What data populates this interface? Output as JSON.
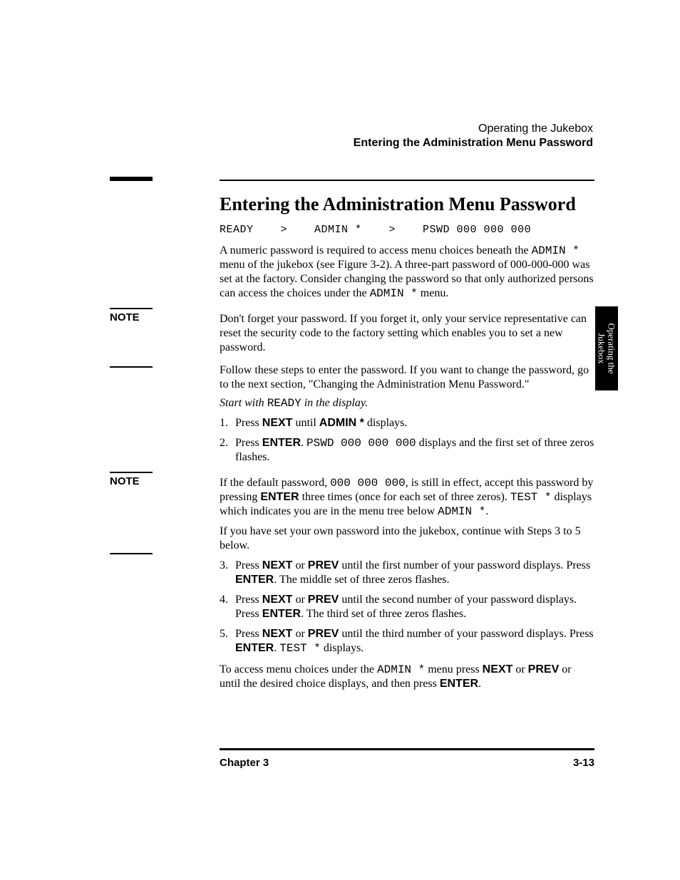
{
  "header": {
    "chapter_name": "Operating the Jukebox",
    "section_name": "Entering the Administration Menu Password"
  },
  "side_tab": {
    "line1": "Operating the",
    "line2": "Jukebox"
  },
  "title": "Entering the Administration Menu Password",
  "display_sequence": "READY    >    ADMIN *    >    PSWD 000 000 000",
  "intro_para": {
    "t1": "A numeric password is required to access menu choices beneath the ",
    "mono1": "ADMIN *",
    "t2": " menu of the jukebox (see Figure 3-2). A three-part password of 000-000-000 was set at the factory. Consider changing the password so that only authorized persons can access the choices under the ",
    "mono2": "ADMIN *",
    "t3": " menu."
  },
  "note1": {
    "label": "NOTE",
    "text": "Don't forget your password. If you forget it, only your service representative can reset the security code to the factory setting which enables you to set a new password."
  },
  "follow_para": "Follow these steps to enter the password. If you want to change the password, go to the next section, \"Changing the Administration Menu Password.\"",
  "start_line": {
    "t1": "Start with ",
    "mono": "READY",
    "t2": " in the display."
  },
  "steps_a": [
    {
      "num": "1.",
      "parts": [
        {
          "text": "Press "
        },
        {
          "text": "NEXT",
          "cls": "sans bold"
        },
        {
          "text": " until "
        },
        {
          "text": "ADMIN *",
          "cls": "sans bold"
        },
        {
          "text": " displays."
        }
      ]
    },
    {
      "num": "2.",
      "parts": [
        {
          "text": "Press "
        },
        {
          "text": "ENTER",
          "cls": "sans bold"
        },
        {
          "text": ". "
        },
        {
          "text": "PSWD 000 000 000",
          "cls": "mono"
        },
        {
          "text": " displays and the first set of three zeros flashes."
        }
      ]
    }
  ],
  "note2": {
    "label": "NOTE",
    "parts": [
      {
        "text": "If the default password, "
      },
      {
        "text": "000 000 000",
        "cls": "mono"
      },
      {
        "text": ", is still in effect, accept this password by pressing "
      },
      {
        "text": "ENTER",
        "cls": "sans bold"
      },
      {
        "text": " three times (once for each set of three zeros).  "
      },
      {
        "text": "TEST *",
        "cls": "mono"
      },
      {
        "text": " displays which indicates you are in the menu tree below "
      },
      {
        "text": "ADMIN *",
        "cls": "mono"
      },
      {
        "text": "."
      }
    ]
  },
  "ifown_para": "If you have set your own password into the jukebox, continue with Steps 3 to 5 below.",
  "steps_b": [
    {
      "num": "3.",
      "parts": [
        {
          "text": "Press "
        },
        {
          "text": "NEXT",
          "cls": "sans bold"
        },
        {
          "text": " or "
        },
        {
          "text": "PREV",
          "cls": "sans bold"
        },
        {
          "text": " until the first number of your password displays. Press "
        },
        {
          "text": "ENTER",
          "cls": "sans bold"
        },
        {
          "text": ". The middle set of three zeros flashes."
        }
      ]
    },
    {
      "num": "4.",
      "parts": [
        {
          "text": "Press "
        },
        {
          "text": "NEXT",
          "cls": "sans bold"
        },
        {
          "text": " or "
        },
        {
          "text": "PREV",
          "cls": "sans bold"
        },
        {
          "text": " until the second number of your password displays. Press "
        },
        {
          "text": "ENTER",
          "cls": "sans bold"
        },
        {
          "text": ". The third set of three zeros flashes."
        }
      ]
    },
    {
      "num": "5.",
      "parts": [
        {
          "text": "Press "
        },
        {
          "text": "NEXT",
          "cls": "sans bold"
        },
        {
          "text": " or "
        },
        {
          "text": "PREV",
          "cls": "sans bold"
        },
        {
          "text": " until the third number of your password displays. Press "
        },
        {
          "text": "ENTER",
          "cls": "sans bold"
        },
        {
          "text": ". "
        },
        {
          "text": "TEST *",
          "cls": "mono"
        },
        {
          "text": " displays."
        }
      ]
    }
  ],
  "access_para": {
    "parts": [
      {
        "text": "To access menu choices under the "
      },
      {
        "text": "ADMIN *",
        "cls": "mono"
      },
      {
        "text": " menu press "
      },
      {
        "text": "NEXT",
        "cls": "sans bold"
      },
      {
        "text": " or "
      },
      {
        "text": "PREV",
        "cls": "sans bold"
      },
      {
        "text": " or until the desired choice displays, and then press "
      },
      {
        "text": "ENTER",
        "cls": "sans bold"
      },
      {
        "text": "."
      }
    ]
  },
  "footer": {
    "chapter": "Chapter 3",
    "page": "3-13"
  }
}
